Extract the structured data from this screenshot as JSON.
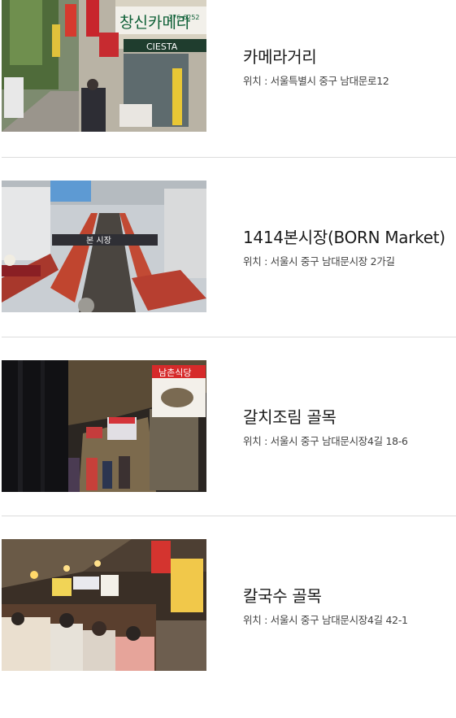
{
  "places": [
    {
      "title": "카메라거리",
      "location": "위치 : 서울특별시 중구 남대문로12",
      "photo": "camera-street-photo"
    },
    {
      "title": "1414본시장(BORN Market)",
      "location": "위치 : 서울시 중구 남대문시장 2가길",
      "photo": "born-market-photo"
    },
    {
      "title": "갈치조림 골목",
      "location": "위치 : 서울시 중구 남대문시장4길 18-6",
      "photo": "galchi-alley-photo"
    },
    {
      "title": "칼국수 골목",
      "location": "위치 : 서울시 중구 남대문시장4길 42-1",
      "photo": "kalguksu-alley-photo"
    }
  ],
  "signs": {
    "camera_shop_sign": "창신카메라",
    "camera_shop_phone": "776-6252",
    "camera_brand_sign": "CIESTA",
    "born_market_sign": "본 시장",
    "galchi_restaurant_sign": "남촌식당"
  },
  "colors": {
    "title_text": "#1a1a1a",
    "location_text": "#444444",
    "divider": "#dcdcdc"
  }
}
